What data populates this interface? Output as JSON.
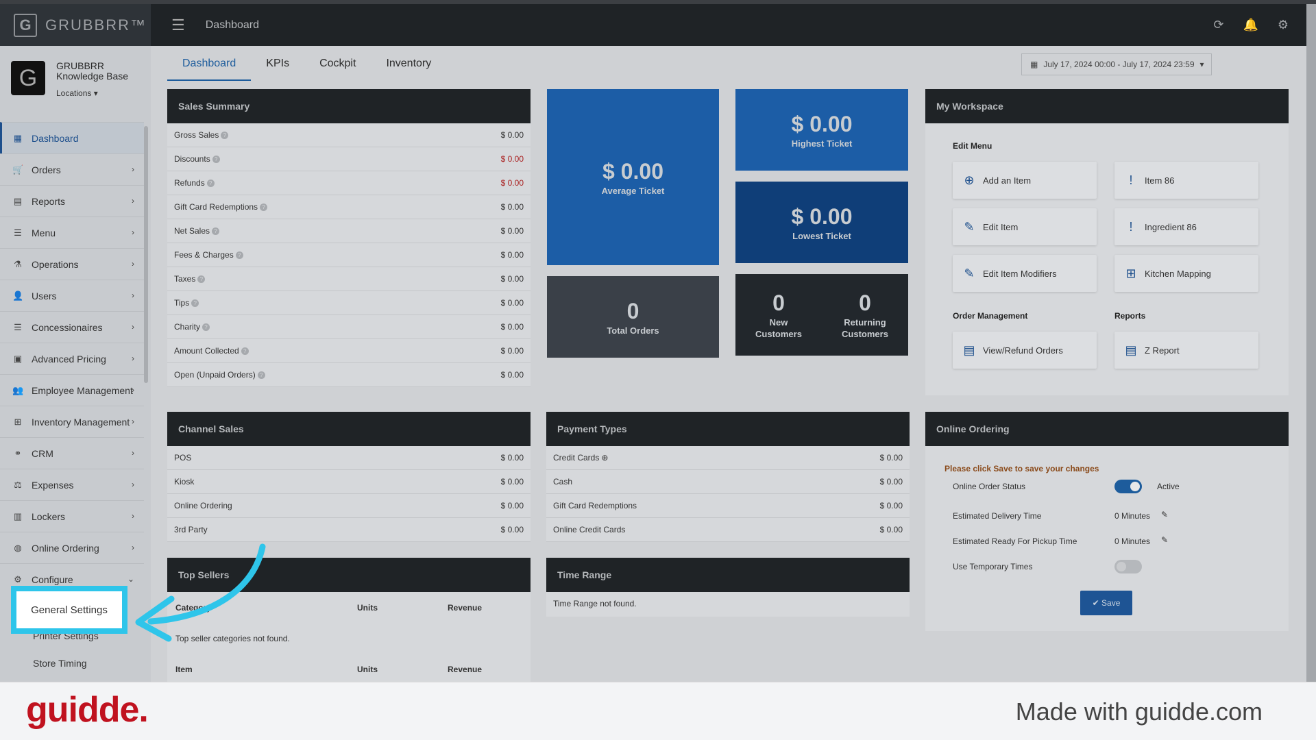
{
  "brand": {
    "name": "GRUBBRR™",
    "logo_letter": "G"
  },
  "org": {
    "name_line1": "GRUBBRR",
    "name_line2": "Knowledge Base",
    "locations_label": "Locations ▾"
  },
  "header": {
    "title": "Dashboard"
  },
  "sidebar": {
    "items": [
      {
        "label": "Dashboard",
        "icon": "dashboard-icon",
        "glyph": "▦"
      },
      {
        "label": "Orders",
        "icon": "cart-icon",
        "glyph": "🛒"
      },
      {
        "label": "Reports",
        "icon": "report-icon",
        "glyph": "▤"
      },
      {
        "label": "Menu",
        "icon": "list-icon",
        "glyph": "☰"
      },
      {
        "label": "Operations",
        "icon": "flask-icon",
        "glyph": "⚗"
      },
      {
        "label": "Users",
        "icon": "user-plus-icon",
        "glyph": "👤"
      },
      {
        "label": "Concessionaires",
        "icon": "list-icon",
        "glyph": "☰"
      },
      {
        "label": "Advanced Pricing",
        "icon": "money-icon",
        "glyph": "▣"
      },
      {
        "label": "Employee Management",
        "icon": "users-icon",
        "glyph": "👥"
      },
      {
        "label": "Inventory Management",
        "icon": "sitemap-icon",
        "glyph": "⊞"
      },
      {
        "label": "CRM",
        "icon": "link-icon",
        "glyph": "⚭"
      },
      {
        "label": "Expenses",
        "icon": "balance-icon",
        "glyph": "⚖"
      },
      {
        "label": "Lockers",
        "icon": "locker-icon",
        "glyph": "▥"
      },
      {
        "label": "Online Ordering",
        "icon": "globe-icon",
        "glyph": "◍"
      },
      {
        "label": "Configure",
        "icon": "gear-icon",
        "glyph": "⚙"
      }
    ],
    "subitems": [
      "General Settings",
      "Printer Settings",
      "Store Timing"
    ]
  },
  "tabs": [
    "Dashboard",
    "KPIs",
    "Cockpit",
    "Inventory"
  ],
  "date_range": "July 17, 2024 00:00 - July 17, 2024 23:59",
  "sales_summary": {
    "title": "Sales Summary",
    "rows": [
      {
        "label": "Gross Sales",
        "value": "$ 0.00",
        "red": false
      },
      {
        "label": "Discounts",
        "value": "$ 0.00",
        "red": true
      },
      {
        "label": "Refunds",
        "value": "$ 0.00",
        "red": true
      },
      {
        "label": "Gift Card Redemptions",
        "value": "$ 0.00",
        "red": false
      },
      {
        "label": "Net Sales",
        "value": "$ 0.00",
        "red": false
      },
      {
        "label": "Fees & Charges",
        "value": "$ 0.00",
        "red": false
      },
      {
        "label": "Taxes",
        "value": "$ 0.00",
        "red": false
      },
      {
        "label": "Tips",
        "value": "$ 0.00",
        "red": false
      },
      {
        "label": "Charity",
        "value": "$ 0.00",
        "red": false
      },
      {
        "label": "Amount Collected",
        "value": "$ 0.00",
        "red": false
      },
      {
        "label": "Open (Unpaid Orders)",
        "value": "$ 0.00",
        "red": false
      }
    ]
  },
  "tiles": {
    "average": {
      "value": "$ 0.00",
      "label": "Average Ticket"
    },
    "highest": {
      "value": "$ 0.00",
      "label": "Highest Ticket"
    },
    "lowest": {
      "value": "$ 0.00",
      "label": "Lowest Ticket"
    },
    "total_orders": {
      "value": "0",
      "label": "Total Orders"
    },
    "new_customers": {
      "value": "0",
      "label1": "New",
      "label2": "Customers"
    },
    "returning_customers": {
      "value": "0",
      "label1": "Returning",
      "label2": "Customers"
    }
  },
  "workspace": {
    "title": "My Workspace",
    "edit_menu": "Edit Menu",
    "order_mgmt": "Order Management",
    "reports": "Reports",
    "buttons": [
      "Add an Item",
      "Item 86",
      "Edit Item",
      "Ingredient 86",
      "Edit Item Modifiers",
      "Kitchen Mapping",
      "View/Refund Orders",
      "Z Report"
    ]
  },
  "channel_sales": {
    "title": "Channel Sales",
    "rows": [
      {
        "label": "POS",
        "value": "$ 0.00"
      },
      {
        "label": "Kiosk",
        "value": "$ 0.00"
      },
      {
        "label": "Online Ordering",
        "value": "$ 0.00"
      },
      {
        "label": "3rd Party",
        "value": "$ 0.00"
      }
    ]
  },
  "payment_types": {
    "title": "Payment Types",
    "rows": [
      {
        "label": "Credit Cards",
        "value": "$ 0.00"
      },
      {
        "label": "Cash",
        "value": "$ 0.00"
      },
      {
        "label": "Gift Card Redemptions",
        "value": "$ 0.00"
      },
      {
        "label": "Online Credit Cards",
        "value": "$ 0.00"
      }
    ]
  },
  "online_ordering": {
    "title": "Online Ordering",
    "notice": "Please click Save to save your changes",
    "status_label": "Online Order Status",
    "status_value": "Active",
    "status_on": true,
    "delivery_label": "Estimated Delivery Time",
    "delivery_value": "0 Minutes",
    "pickup_label": "Estimated Ready For Pickup Time",
    "pickup_value": "0 Minutes",
    "temp_label": "Use Temporary Times",
    "temp_on": false,
    "save_label": "✔ Save"
  },
  "top_sellers": {
    "title": "Top Sellers",
    "col1": "Category",
    "col2": "Units",
    "col3": "Revenue",
    "empty": "Top seller categories not found.",
    "col1b": "Item",
    "col2b": "Units",
    "col3b": "Revenue"
  },
  "time_range": {
    "title": "Time Range",
    "empty": "Time Range not found."
  },
  "footer": {
    "logo": "guidde.",
    "made_with": "Made with guidde.com"
  },
  "colors": {
    "accent": "#1d5c9c",
    "highlight": "#2ec5ea",
    "guidde_red": "#c0121f"
  }
}
